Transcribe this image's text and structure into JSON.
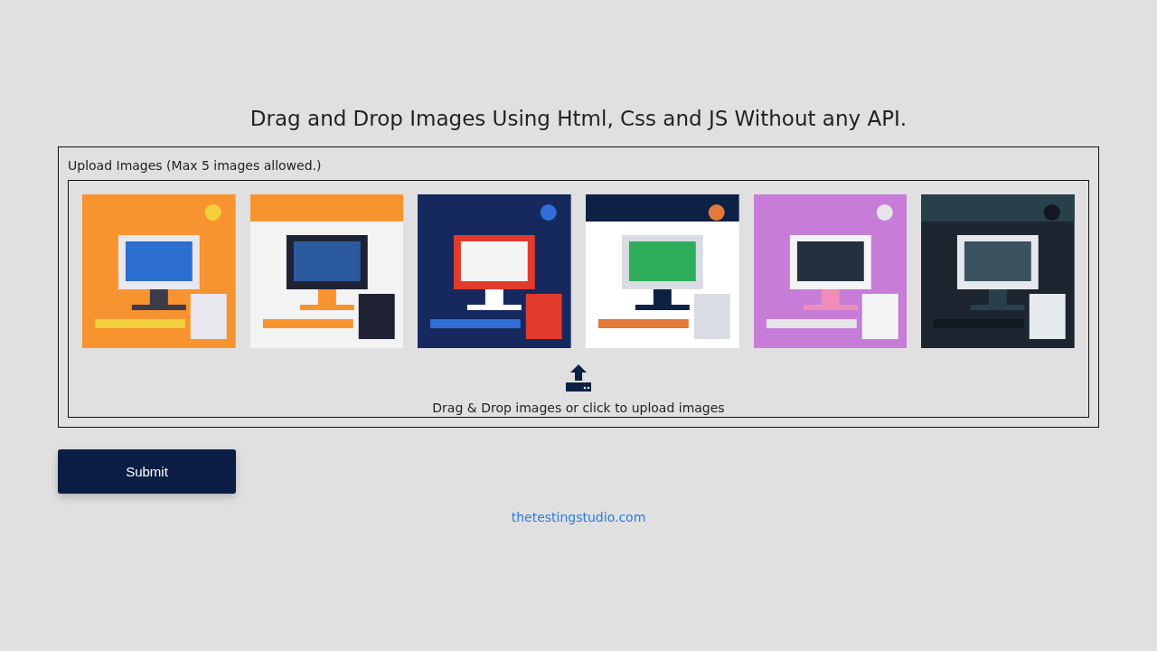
{
  "title": "Drag and Drop Images Using Html, Css and JS Without any API.",
  "upload": {
    "label": "Upload Images (Max 5 images allowed.)",
    "hint": "Drag & Drop images or click to upload images"
  },
  "submit": "Submit",
  "footer_link": "thetestingstudio.com"
}
